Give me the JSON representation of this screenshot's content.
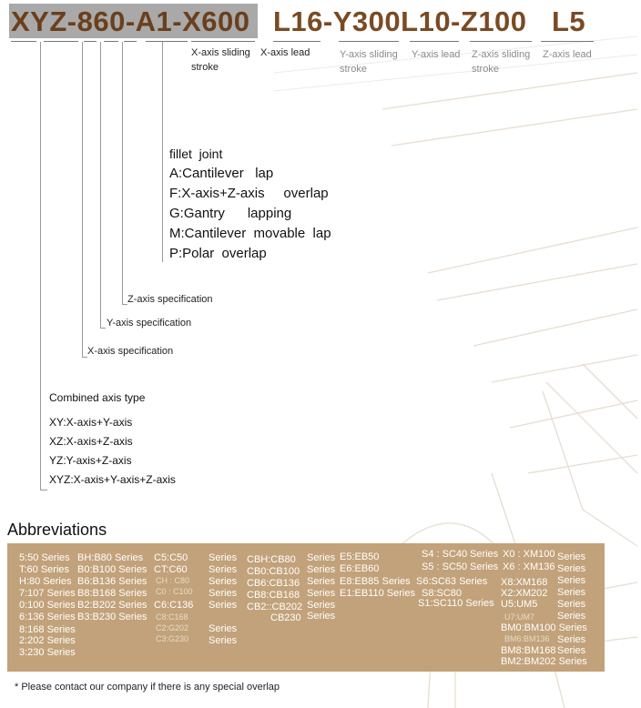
{
  "model_code": {
    "segments": [
      "XYZ-860-A1-X600",
      "L16-Y300L10-Z100",
      "L5"
    ]
  },
  "axis_captions": {
    "x_stroke": "X-axis sliding stroke",
    "x_lead": "X-axis lead",
    "y_stroke": "Y-axis sliding stroke",
    "y_lead": "Y-axis lead",
    "z_stroke": "Z-axis sliding stroke",
    "z_lead": "Z-axis lead"
  },
  "joint": {
    "heading": "fillet  joint",
    "options": [
      "A:Cantilever   lap",
      "F:X-axis+Z-axis     overlap",
      "G:Gantry      lapping",
      "M:Cantilever  movable  lap",
      "P:Polar  overlap"
    ]
  },
  "spec_labels": {
    "z": "Z-axis specification",
    "y": "Y-axis  specification",
    "x": "X-axis specification"
  },
  "combined": {
    "heading": "Combined axis type",
    "items": [
      "XY:X-axis+Y-axis",
      "XZ:X-axis+Z-axis",
      "YZ:Y-axis+Z-axis",
      "XYZ:X-axis+Y-axis+Z-axis"
    ]
  },
  "abbreviations": {
    "title": "Abbreviations",
    "col1": [
      "5:50  Series",
      "T:60 Series",
      "H:80 Series",
      "7:107 Series",
      "0:100 Series",
      "6:136 Series",
      "8:168 Series",
      "2:202 Series",
      "3:230 Series"
    ],
    "col2": [
      "BH:B80  Series",
      "B0:B100 Series",
      "B6:B136 Series",
      "B8:B168 Series",
      "B2:B202 Series",
      "B3:B230 Series"
    ],
    "col3": [
      "C5:C50",
      "CT:C60",
      "CH : C80",
      "C0 : C100",
      "C6:C136",
      "C8:C168",
      "C2:G202",
      "C3:G230"
    ],
    "col3_series": [
      "Series",
      "Series",
      "Series",
      "Series",
      "Series",
      "Series",
      "Series"
    ],
    "col4": [
      "CBH:CB80",
      "CB0:CB100",
      "CB6:CB136",
      "CB8:CB168",
      "CB2::CB202",
      "CB230"
    ],
    "col4_series": [
      "Series",
      "Series",
      "Series",
      "Series",
      "Series",
      "Series"
    ],
    "col5": [
      "E5:EB50",
      "E6:EB60",
      "E8:EB85 Series",
      "E1:EB110 Series"
    ],
    "col6": [
      "S4 : SC40",
      "S5 : SC50",
      "S6:SC63 Series",
      "S8:SC80",
      "S1:SC110 Series"
    ],
    "col6_series": [
      "Series",
      "Series"
    ],
    "col7": [
      "X0 : XM100",
      "X6 : XM136",
      "X8:XM168",
      "X2:XM202",
      "U5:UM5",
      "U7:UM7",
      "BM0:BM100 Series",
      "BM6:BM136",
      "BM8:BM168",
      "BM2:BM202 Series"
    ],
    "col7_series": [
      "Series",
      "Series",
      "Series",
      "Series",
      "Series",
      "Series",
      "Series",
      "Series"
    ]
  },
  "footnote": "* Please contact our company if there is any special overlap"
}
